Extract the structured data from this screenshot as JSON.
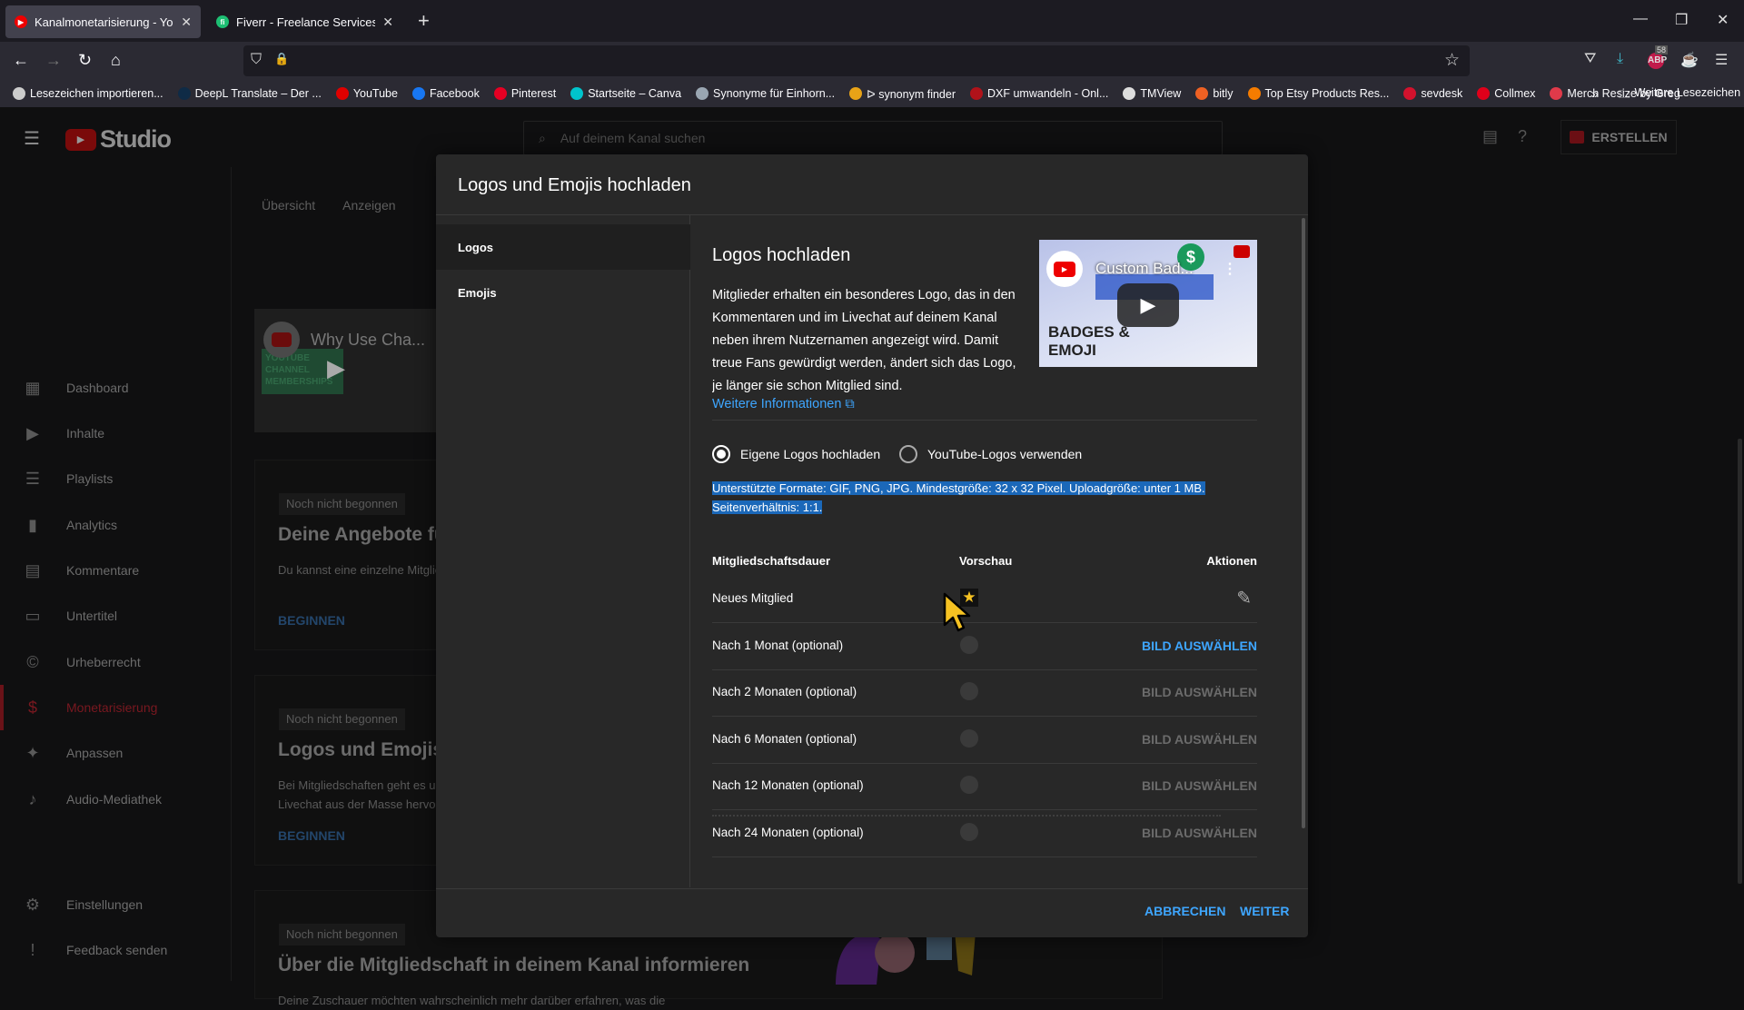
{
  "browser": {
    "tabs": [
      {
        "title": "Kanalmonetarisierung - YouTube Studio",
        "favicon": "youtube-icon",
        "active": true
      },
      {
        "title": "Fiverr - Freelance Services Marketplace",
        "favicon": "fiverr-icon",
        "active": false
      }
    ],
    "new_tab": "+",
    "window_controls": {
      "minimize": "—",
      "restore": "❐",
      "close": "✕"
    },
    "nav": {
      "back": "←",
      "forward": "→",
      "reload": "↻",
      "home": "⌂"
    },
    "url_icons": {
      "shield": "⛉",
      "lock": "🔒"
    },
    "toolbar": {
      "bookmark_star": "☆",
      "pocket": "⛛",
      "download": "⤓",
      "adblock_count": "58",
      "adblock_label": "ABP",
      "extension": "☕",
      "menu": "☰"
    },
    "bookmarks": [
      {
        "label": "Lesezeichen importieren...",
        "color": "#cccccc"
      },
      {
        "label": "DeepL Translate – Der ...",
        "color": "#0f2b46"
      },
      {
        "label": "YouTube",
        "color": "#e00000"
      },
      {
        "label": "Facebook",
        "color": "#1877f2"
      },
      {
        "label": "Pinterest",
        "color": "#e60023"
      },
      {
        "label": "Startseite – Canva",
        "color": "#00c4cc"
      },
      {
        "label": "Synonyme für Einhorn...",
        "color": "#9aa6b2"
      },
      {
        "label": "ᐅ synonym finder",
        "color": "#e8a317"
      },
      {
        "label": "DXF umwandeln - Onl...",
        "color": "#b0121a"
      },
      {
        "label": "TMView",
        "color": "#dddddd"
      },
      {
        "label": "bitly",
        "color": "#ee6123"
      },
      {
        "label": "Top Etsy Products Res...",
        "color": "#f57c00"
      },
      {
        "label": "sevdesk",
        "color": "#d3122d"
      },
      {
        "label": "Collmex",
        "color": "#e0001a"
      },
      {
        "label": "Merch Resize by Greg",
        "color": "#e03a4a"
      }
    ],
    "bookmarks_overflow": "»",
    "other_bookmarks": "Weitere Lesezeichen"
  },
  "studio": {
    "logo_text": "Studio",
    "search_placeholder": "Auf deinem Kanal suchen",
    "create_label": "ERSTELLEN",
    "sidebar": [
      {
        "label": "Dashboard",
        "icon": "▦",
        "active": false
      },
      {
        "label": "Inhalte",
        "icon": "▶",
        "active": false
      },
      {
        "label": "Playlists",
        "icon": "☰",
        "active": false
      },
      {
        "label": "Analytics",
        "icon": "▮",
        "active": false
      },
      {
        "label": "Kommentare",
        "icon": "▤",
        "active": false
      },
      {
        "label": "Untertitel",
        "icon": "▭",
        "active": false
      },
      {
        "label": "Urheberrecht",
        "icon": "©",
        "active": false
      },
      {
        "label": "Monetarisierung",
        "icon": "$",
        "active": true
      },
      {
        "label": "Anpassen",
        "icon": "✦",
        "active": false
      },
      {
        "label": "Audio-Mediathek",
        "icon": "♪",
        "active": false
      }
    ],
    "sidebar_bottom": [
      {
        "label": "Einstellungen",
        "icon": "⚙"
      },
      {
        "label": "Feedback senden",
        "icon": "!"
      }
    ],
    "tabs": [
      "Übersicht",
      "Anzeigen"
    ],
    "video": {
      "title": "Why Use Cha...",
      "sign": "YOUTUBE CHANNEL MEMBERSHIPS"
    },
    "cards": [
      {
        "badge": "Noch nicht begonnen",
        "title": "Deine Angebote für Mitglieder",
        "text": "Du kannst eine einzelne Mitgliedschaftsstufe oder mehrere Stufen anbieten. Überlege dir einzigartige Vorteile, die du deinen Mitgliedern bieten kannst.",
        "action": "BEGINNEN"
      },
      {
        "badge": "Noch nicht begonnen",
        "title": "Logos und Emojis hochladen",
        "text": "Bei Mitgliedschaften geht es um Gemeinschaft. Mit Logos und Emojis, die Mitgliedern vorbehalten sind, heben sich deine Mitglieder in Kommentaren und im Livechat aus der Masse hervor.",
        "action": "BEGINNEN"
      },
      {
        "badge": "Noch nicht begonnen",
        "title": "Über die Mitgliedschaft in deinem Kanal informieren",
        "text": "Deine Zuschauer möchten wahrscheinlich mehr darüber erfahren, was die"
      }
    ]
  },
  "modal": {
    "title": "Logos und Emojis hochladen",
    "nav": [
      {
        "label": "Logos",
        "selected": true
      },
      {
        "label": "Emojis",
        "selected": false
      }
    ],
    "heading": "Logos hochladen",
    "description": "Mitglieder erhalten ein besonderes Logo, das in den Kommentaren und im Livechat auf deinem Kanal neben ihrem Nutzernamen angezeigt wird. Damit treue Fans gewürdigt werden, ändert sich das Logo, je länger sie schon Mitglied sind.",
    "more_info": "Weitere Informationen",
    "video": {
      "title": "Custom Bad...",
      "caption_line1": "BADGES &",
      "caption_line2": "EMOJI"
    },
    "radio_options": [
      {
        "label": "Eigene Logos hochladen",
        "checked": true
      },
      {
        "label": "YouTube-Logos verwenden",
        "checked": false
      }
    ],
    "formats_text": "Unterstützte Formate: GIF, PNG, JPG. Mindestgröße: 32 x 32 Pixel. Uploadgröße: unter 1 MB. Seitenverhältnis: 1:1.",
    "table": {
      "headers": [
        "Mitgliedschaftsdauer",
        "Vorschau",
        "Aktionen"
      ],
      "rows": [
        {
          "label": "Neues Mitglied",
          "preview": "star",
          "action": "edit",
          "enabled": true
        },
        {
          "label": "Nach 1 Monat (optional)",
          "preview": "empty",
          "action": "BILD AUSWÄHLEN",
          "enabled": true
        },
        {
          "label": "Nach 2 Monaten (optional)",
          "preview": "empty",
          "action": "BILD AUSWÄHLEN",
          "enabled": false
        },
        {
          "label": "Nach 6 Monaten (optional)",
          "preview": "empty",
          "action": "BILD AUSWÄHLEN",
          "enabled": false
        },
        {
          "label": "Nach 12 Monaten (optional)",
          "preview": "empty",
          "action": "BILD AUSWÄHLEN",
          "enabled": false
        },
        {
          "label": "Nach 24 Monaten (optional)",
          "preview": "empty",
          "action": "BILD AUSWÄHLEN",
          "enabled": false
        }
      ]
    },
    "cancel_label": "ABBRECHEN",
    "next_label": "WEITER",
    "accent_color": "#3ea6ff",
    "selection_color": "#1b68b9"
  }
}
